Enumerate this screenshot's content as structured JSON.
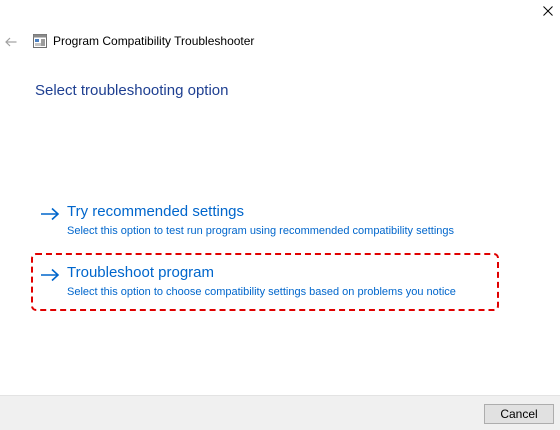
{
  "window": {
    "title": "Program Compatibility Troubleshooter",
    "back_icon": "back-arrow-icon",
    "close_icon": "close-icon",
    "app_icon": "troubleshooter-app-icon"
  },
  "main": {
    "heading": "Select troubleshooting option",
    "options": [
      {
        "title": "Try recommended settings",
        "description": "Select this option to test run program using recommended compatibility settings",
        "icon": "arrow-right-icon"
      },
      {
        "title": "Troubleshoot program",
        "description": "Select this option to choose compatibility settings based on problems you notice",
        "icon": "arrow-right-icon",
        "highlighted": true
      }
    ]
  },
  "footer": {
    "cancel_label": "Cancel"
  },
  "colors": {
    "heading": "#1e3f91",
    "link": "#0066cc",
    "highlight": "#e00000",
    "footer_bg": "#f0f0f0"
  }
}
